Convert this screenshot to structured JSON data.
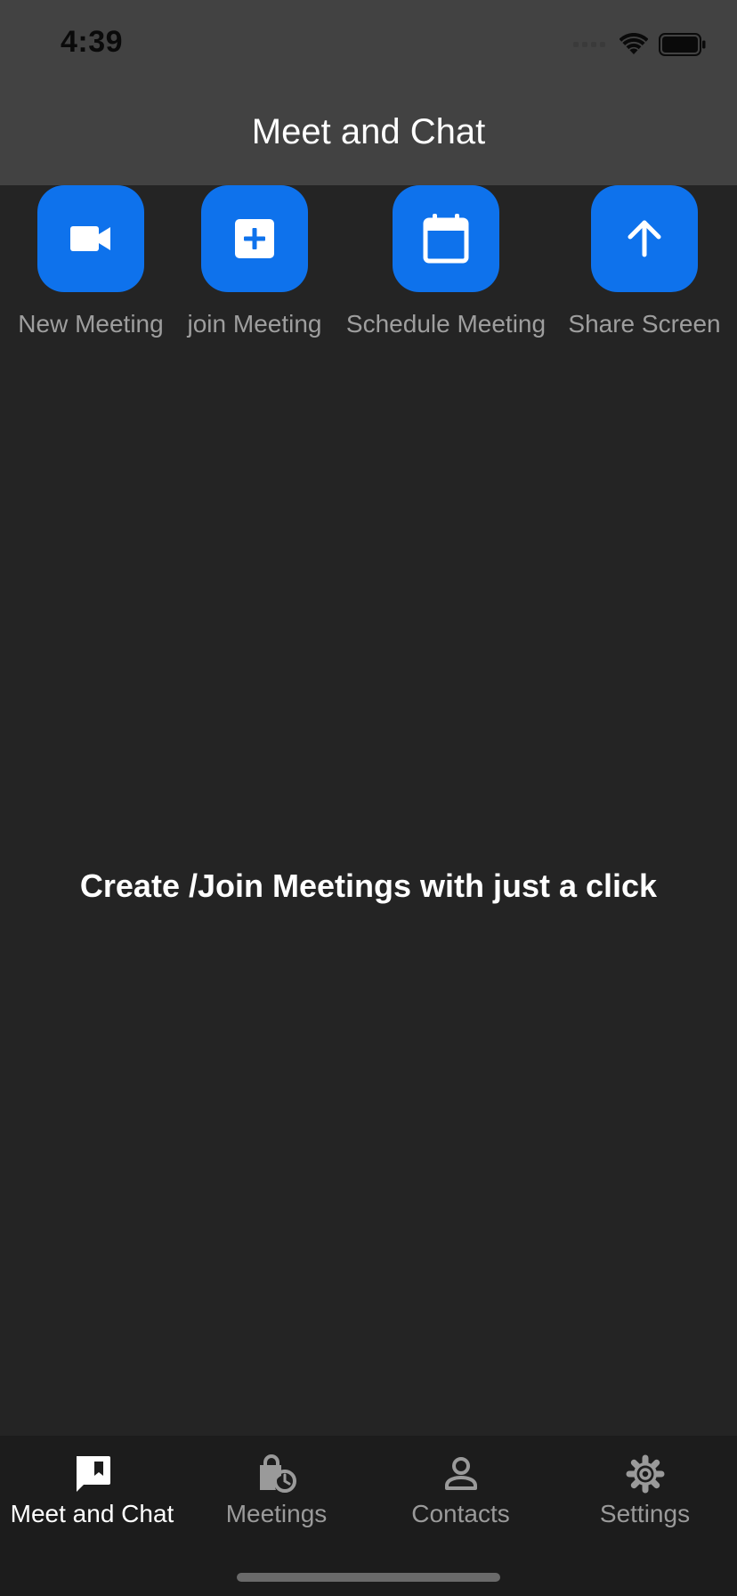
{
  "status_bar": {
    "time": "4:39",
    "icons": [
      "signal-icon",
      "wifi-icon",
      "battery-icon"
    ]
  },
  "app_bar": {
    "title": "Meet and Chat"
  },
  "actions": [
    {
      "label": "New Meeting",
      "icon": "video-camera-icon"
    },
    {
      "label": "join Meeting",
      "icon": "add-box-icon"
    },
    {
      "label": "Schedule Meeting",
      "icon": "calendar-icon"
    },
    {
      "label": "Share Screen",
      "icon": "arrow-up-icon"
    }
  ],
  "main": {
    "headline": "Create /Join Meetings with just a click"
  },
  "bottom_nav": {
    "items": [
      {
        "label": "Meet and Chat",
        "icon": "chat-bookmark-icon",
        "active": true
      },
      {
        "label": "Meetings",
        "icon": "lock-clock-icon",
        "active": false
      },
      {
        "label": "Contacts",
        "icon": "person-icon",
        "active": false
      },
      {
        "label": "Settings",
        "icon": "gear-icon",
        "active": false
      }
    ]
  },
  "colors": {
    "background": "#242424",
    "app_bar": "#424242",
    "accent": "#0e72ec",
    "nav_background": "#1c1c1c",
    "inactive_text": "#9e9e9e"
  }
}
